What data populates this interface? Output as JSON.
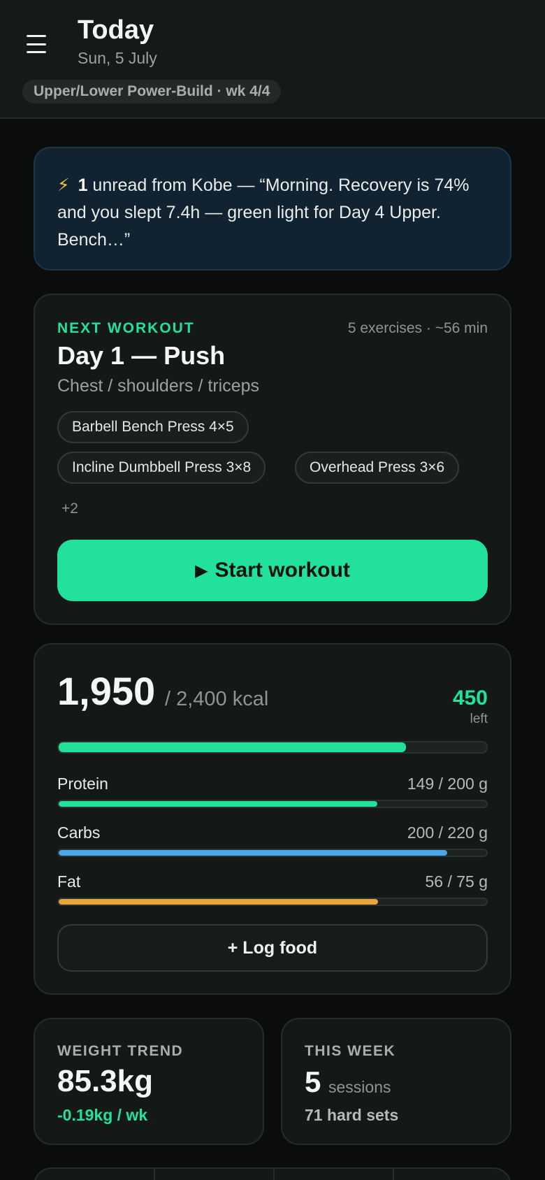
{
  "header": {
    "title": "Today",
    "date": "Sun, 5 July",
    "program": "Upper/Lower Power-Build · wk 4/4"
  },
  "message": {
    "icon": "lightning-bolt",
    "count": "1",
    "text": " unread from Kobe — “Morning. Recovery is 74% and you slept 7.4h — green light for Day 4 Upper. Bench…”"
  },
  "workout": {
    "eyebrow": "NEXT WORKOUT",
    "meta": "5 exercises · ~56 min",
    "title": "Day 1 — Push",
    "subtitle": "Chest / shoulders / triceps",
    "exercises": [
      "Barbell Bench Press 4×5",
      "Incline Dumbbell Press 3×8",
      "Overhead Press 3×6"
    ],
    "more": "+2",
    "start_label": "Start workout"
  },
  "nutrition": {
    "eaten": "1,950",
    "goal": "/ 2,400 kcal",
    "left_value": "450",
    "left_label": "left",
    "calorie_progress": 0.8125,
    "macros": [
      {
        "name": "Protein",
        "value": "149 / 200 g",
        "progress": 0.745,
        "color": "#22e19b"
      },
      {
        "name": "Carbs",
        "value": "200 / 220 g",
        "progress": 0.909,
        "color": "#4aa8e8"
      },
      {
        "name": "Fat",
        "value": "56 / 75 g",
        "progress": 0.747,
        "color": "#e8a53a"
      }
    ],
    "log_label": "+ Log food"
  },
  "weight": {
    "label": "WEIGHT TREND",
    "value": "85.3kg",
    "delta": "-0.19kg / wk"
  },
  "week": {
    "label": "THIS WEEK",
    "sessions": "5",
    "sessions_unit": "sessions",
    "hard_sets": "71 hard sets"
  },
  "colors": {
    "accent": "#22e19b",
    "background": "#0b0d0d",
    "card": "#141817"
  }
}
